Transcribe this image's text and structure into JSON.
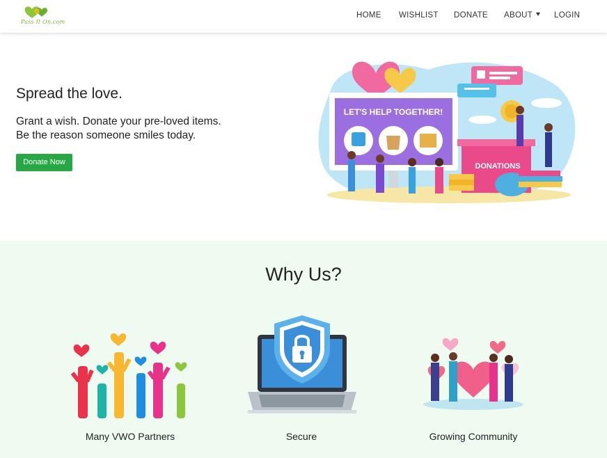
{
  "brand": {
    "logo_text": "Pass It On.com"
  },
  "nav": {
    "items": [
      {
        "label": "HOME",
        "active": true
      },
      {
        "label": "WISHLIST",
        "active": false
      },
      {
        "label": "DONATE",
        "active": false
      },
      {
        "label": "ABOUT",
        "active": false,
        "has_dropdown": true
      },
      {
        "label": "LOGIN",
        "active": false
      }
    ],
    "active_color": "#4fae5a"
  },
  "hero": {
    "title": "Spread the love.",
    "line1": "Grant a wish. Donate your pre-loved items.",
    "line2": "Be the reason someone smiles today.",
    "cta_label": "Donate Now",
    "cta_color": "#28a745",
    "illustration": {
      "banner_text": "LET'S HELP TOGETHER!",
      "box_text": "DONATIONS"
    }
  },
  "why_us": {
    "title": "Why Us?",
    "background": "#effbf1",
    "features": [
      {
        "label": "Many VWO Partners",
        "icon": "raised-hands-hearts-icon"
      },
      {
        "label": "Secure",
        "icon": "laptop-shield-lock-icon"
      },
      {
        "label": "Growing Community",
        "icon": "community-hearts-icon"
      }
    ]
  }
}
